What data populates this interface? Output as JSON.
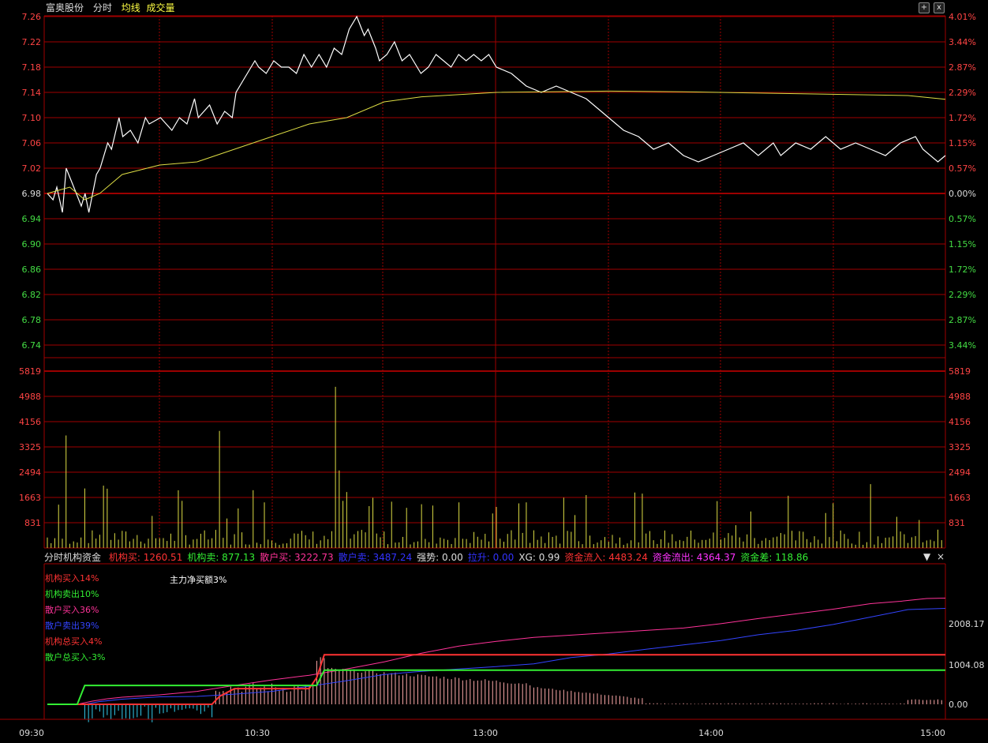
{
  "header": {
    "stock_name": "富奥股份",
    "tab_intraday": "分时",
    "tab_avg": "均线",
    "tab_volume": "成交量",
    "btn_add": "+",
    "btn_close": "x"
  },
  "price_axis": {
    "left_ticks": [
      "7.26",
      "7.22",
      "7.18",
      "7.14",
      "7.10",
      "7.06",
      "7.02",
      "6.98",
      "6.94",
      "6.90",
      "6.86",
      "6.82",
      "6.78",
      "6.74"
    ],
    "right_ticks": [
      "4.01%",
      "3.44%",
      "2.87%",
      "2.29%",
      "1.72%",
      "1.15%",
      "0.57%",
      "0.00%",
      "0.57%",
      "1.15%",
      "1.72%",
      "2.29%",
      "2.87%",
      "3.44%"
    ],
    "base_price": 6.98,
    "up_color": "#ff4444",
    "down_color": "#44dd44",
    "flat_color": "#dddddd"
  },
  "volume_axis": {
    "ticks": [
      "5819",
      "4988",
      "4156",
      "3325",
      "2494",
      "1663",
      "831"
    ]
  },
  "indicator": {
    "name": "分时机构资金",
    "items": [
      {
        "label": "机构买:",
        "value": "1260.51",
        "color": "#ff3333"
      },
      {
        "label": "机构卖:",
        "value": "877.13",
        "color": "#33ee33"
      },
      {
        "label": "散户买:",
        "value": "3222.73",
        "color": "#ff3399"
      },
      {
        "label": "散户卖:",
        "value": "3487.24",
        "color": "#3333ff"
      },
      {
        "label": "强势:",
        "value": "0.00",
        "color": "#dddddd"
      },
      {
        "label": "拉升:",
        "value": "0.00",
        "color": "#3333ff"
      },
      {
        "label": "XG:",
        "value": "0.99",
        "color": "#dddddd"
      },
      {
        "label": "资金流入:",
        "value": "4483.24",
        "color": "#ff3333"
      },
      {
        "label": "资金流出:",
        "value": "4364.37",
        "color": "#ff33ff"
      },
      {
        "label": "资金差:",
        "value": "118.86",
        "color": "#33ee33"
      }
    ],
    "legend": [
      {
        "text": "机构买入14%",
        "color": "#ff3333"
      },
      {
        "text": "机构卖出10%",
        "color": "#33ee33"
      },
      {
        "text": "散户买入36%",
        "color": "#ff3399"
      },
      {
        "text": "散户卖出39%",
        "color": "#3344ff"
      },
      {
        "text": "机构总买入4%",
        "color": "#ff3333"
      },
      {
        "text": "散户总买入-3%",
        "color": "#33ee33"
      }
    ],
    "net_buy": "主力净买额3%",
    "right_ticks": [
      "2008.17",
      "1004.08",
      "0.00"
    ],
    "ctrl_down": "▼",
    "ctrl_close": "×"
  },
  "time_axis": {
    "labels": [
      "09:30",
      "10:30",
      "13:00",
      "14:00",
      "15:00"
    ]
  },
  "colors": {
    "grid_red": "#a00000",
    "price_line": "#ffffff",
    "avg_line": "#dddd44",
    "volume_bar": "#dddd44"
  }
}
